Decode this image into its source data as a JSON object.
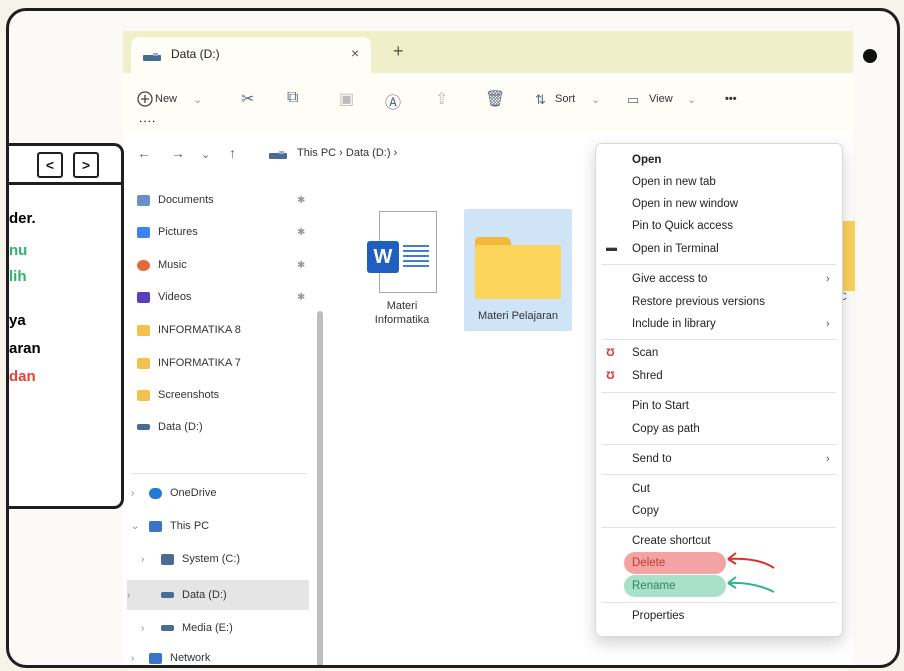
{
  "tab": {
    "title": "Data (D:)",
    "close": "×",
    "add": "+"
  },
  "toolbar": {
    "new_label": "New",
    "sort_label": "Sort",
    "view_label": "View",
    "more": "•••"
  },
  "address": {
    "crumbs": "This PC  ›  Data (D:)  ›"
  },
  "sidebar": {
    "items": [
      {
        "label": "Documents",
        "color": "#6b8fc9"
      },
      {
        "label": "Pictures",
        "color": "#3b82f6"
      },
      {
        "label": "Music",
        "color": "#e46a3a"
      },
      {
        "label": "Videos",
        "color": "#5a3fb8"
      },
      {
        "label": "INFORMATIKA 8",
        "color": "#f2c14e"
      },
      {
        "label": "INFORMATIKA 7",
        "color": "#f2c14e"
      },
      {
        "label": "Screenshots",
        "color": "#f2c14e"
      },
      {
        "label": "Data (D:)",
        "color": "#4a6b94"
      }
    ],
    "tree": [
      {
        "label": "OneDrive",
        "color": "#1f7ad8"
      },
      {
        "label": "This PC",
        "color": "#3a74c9"
      },
      {
        "label": "System (C:)",
        "color": "#4a6b94"
      },
      {
        "label": "Data (D:)",
        "color": "#4a6b94"
      },
      {
        "label": "Media (E:)",
        "color": "#4a6b94"
      },
      {
        "label": "Network",
        "color": "#3a74c9"
      }
    ]
  },
  "files": {
    "word": {
      "label": "Materi Informatika",
      "badge": "W"
    },
    "folder": {
      "label": "Materi Pelajaran"
    },
    "partial": "C"
  },
  "menu": {
    "open": "Open",
    "open_new_tab": "Open in new tab",
    "open_new_window": "Open in new window",
    "pin_quick": "Pin to Quick access",
    "open_terminal": "Open in Terminal",
    "give_access": "Give access to",
    "restore": "Restore previous versions",
    "include_library": "Include in library",
    "scan": "Scan",
    "shred": "Shred",
    "pin_start": "Pin to Start",
    "copy_path": "Copy as path",
    "send_to": "Send to",
    "cut": "Cut",
    "copy": "Copy",
    "create_shortcut": "Create shortcut",
    "delete": "Delete",
    "rename": "Rename",
    "properties": "Properties"
  },
  "left_panel": {
    "lines": [
      {
        "text": "der.",
        "color": "#111111"
      },
      {
        "text": "nu",
        "color": "#2fb36b"
      },
      {
        "text": "lih",
        "color": "#2fb36b"
      },
      {
        "text": "ya",
        "color": "#111111"
      },
      {
        "text": "aran",
        "color": "#111111"
      },
      {
        "text": "dan",
        "color": "#e0433a"
      }
    ]
  },
  "colors": {
    "delete_highlight": "#f4a3a3",
    "rename_highlight": "#a8e0c8",
    "arrow_red": "#d9322f",
    "arrow_green": "#2fb58a"
  }
}
